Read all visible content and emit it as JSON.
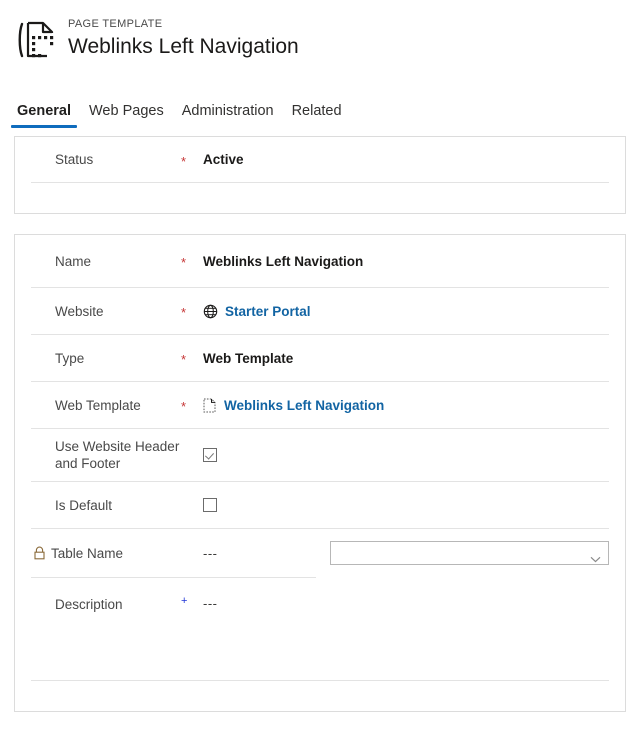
{
  "header": {
    "entity_label": "PAGE TEMPLATE",
    "record_title": "Weblinks Left Navigation",
    "icon": "page-template-icon"
  },
  "tabs": [
    {
      "label": "General",
      "active": true
    },
    {
      "label": "Web Pages",
      "active": false
    },
    {
      "label": "Administration",
      "active": false
    },
    {
      "label": "Related",
      "active": false
    }
  ],
  "status_card": {
    "rows": [
      {
        "label": "Status",
        "required_marker": "*",
        "value": "Active"
      }
    ]
  },
  "main_card": {
    "rows": [
      {
        "label": "Name",
        "required_marker": "*",
        "value": "Weblinks Left Navigation"
      },
      {
        "label": "Website",
        "required_marker": "*",
        "value": "Starter Portal",
        "icon": "globe-icon"
      },
      {
        "label": "Type",
        "required_marker": "*",
        "value": "Web Template"
      },
      {
        "label": "Web Template",
        "required_marker": "*",
        "value": "Weblinks Left Navigation",
        "icon": "document-dashed-icon"
      },
      {
        "label": "Use Website Header and Footer",
        "required_marker": "",
        "value": "checked"
      },
      {
        "label": "Is Default",
        "required_marker": "",
        "value": "unchecked"
      },
      {
        "label": "Table Name",
        "required_marker": "",
        "value": "---",
        "icon": "lock-icon",
        "dropdown_value": ""
      },
      {
        "label": "Description",
        "required_marker": "+",
        "value": "---"
      }
    ]
  },
  "colors": {
    "accent": "#0f6cbd",
    "link": "#1264a3",
    "required": "#c63636",
    "recommended": "#1f35d6",
    "border": "#dcdcdc",
    "divider": "#e3e3e3"
  }
}
